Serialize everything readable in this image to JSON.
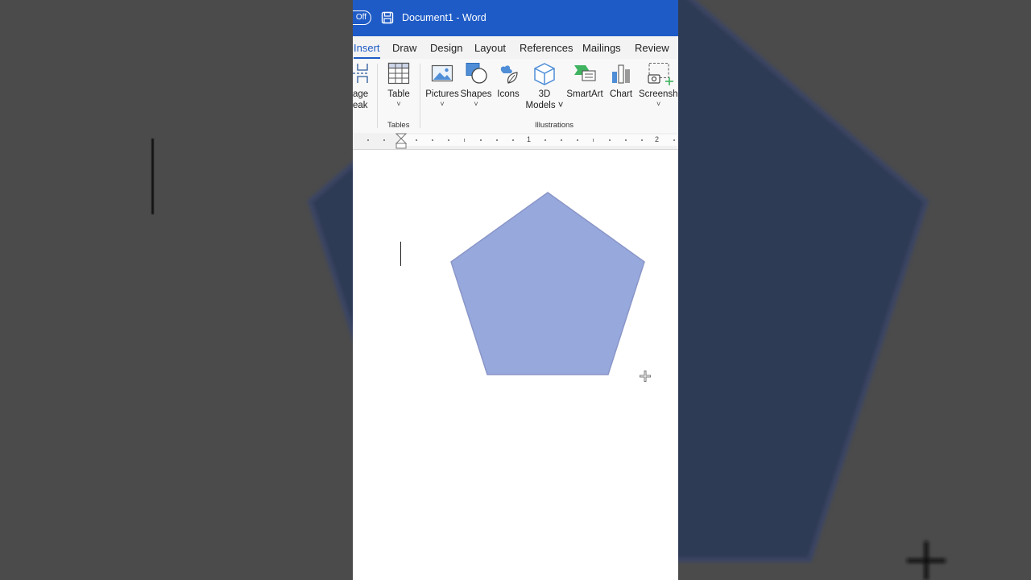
{
  "titlebar": {
    "autosave_state": "Off",
    "document_title": "Document1  -  Word"
  },
  "tabs": [
    {
      "label": "Insert",
      "active": true
    },
    {
      "label": "Draw",
      "active": false
    },
    {
      "label": "Design",
      "active": false
    },
    {
      "label": "Layout",
      "active": false
    },
    {
      "label": "References",
      "active": false
    },
    {
      "label": "Mailings",
      "active": false
    },
    {
      "label": "Review",
      "active": false
    }
  ],
  "ribbon": {
    "page_break": {
      "line1": "age",
      "line2": "eak"
    },
    "table": {
      "label": "Table",
      "chevron": "˅"
    },
    "tables_group": "Tables",
    "pictures": {
      "label": "Pictures",
      "chevron": "˅"
    },
    "shapes": {
      "label": "Shapes",
      "chevron": "˅"
    },
    "icons": {
      "label": "Icons"
    },
    "models3d": {
      "line1": "3D",
      "line2": "Models ˅"
    },
    "smartart": {
      "label": "SmartArt"
    },
    "chart": {
      "label": "Chart"
    },
    "screenshot": {
      "label": "Screensho",
      "chevron": "˅"
    },
    "illustrations_group": "Illustrations"
  },
  "ruler": {
    "marks": [
      "1",
      "2"
    ]
  },
  "colors": {
    "accent": "#1e5bc6",
    "shape_fill": "#97a8dc",
    "shape_stroke": "#8a96c8",
    "background": "#4b4b4b"
  },
  "icons": [
    "save-icon",
    "table-icon",
    "pictures-icon",
    "shapes-icon",
    "icons-icon",
    "3d-models-icon",
    "smartart-icon",
    "chart-icon",
    "screenshot-icon",
    "crosshair-icon"
  ]
}
